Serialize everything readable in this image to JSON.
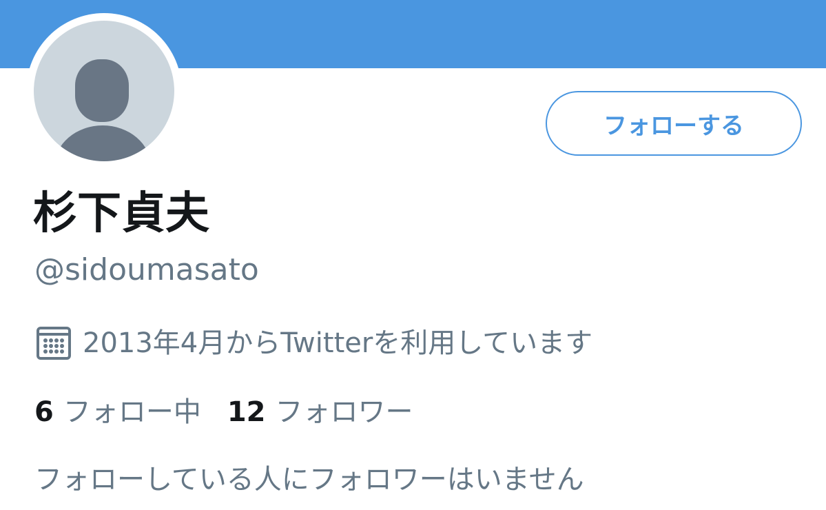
{
  "profile": {
    "display_name": "杉下貞夫",
    "handle": "@sidoumasato",
    "joined_text": "2013年4月からTwitterを利用しています",
    "joined_icon": "calendar-icon",
    "avatar_icon": "default-user-icon"
  },
  "actions": {
    "follow_label": "フォローする"
  },
  "stats": {
    "following_count": "6",
    "following_label": "フォロー中",
    "followers_count": "12",
    "followers_label": "フォロワー"
  },
  "notice": {
    "text": "フォローしている人にフォロワーはいません"
  },
  "colors": {
    "banner": "#4a96e0",
    "accent": "#4a96e0",
    "primary_text": "#14171a",
    "secondary_text": "#657786",
    "avatar_bg": "#ccd6dd",
    "avatar_figure": "#697685"
  }
}
